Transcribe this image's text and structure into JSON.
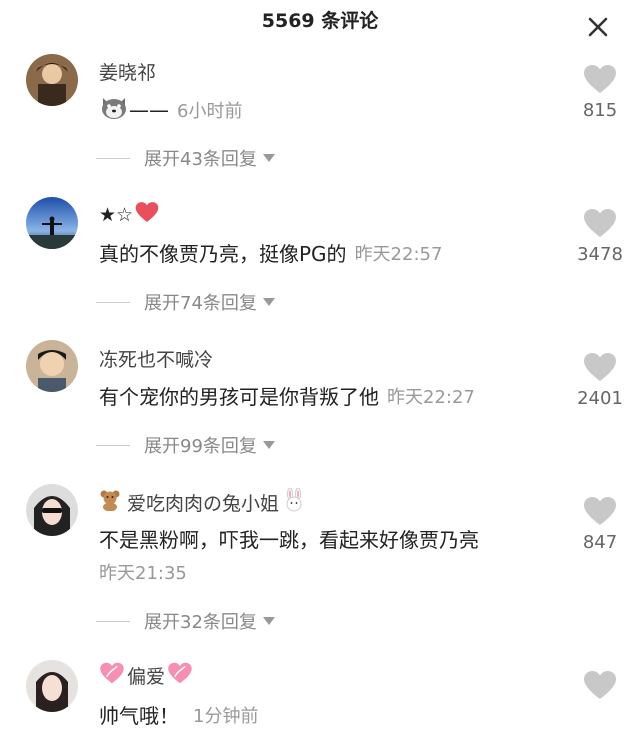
{
  "header": {
    "title": "5569 条评论",
    "close_icon": "close-icon"
  },
  "comments": [
    {
      "username": "姜晓祁",
      "text": "——",
      "time": "6小时前",
      "likes": "815",
      "expand": "展开43条回复"
    },
    {
      "username": "★☆",
      "text": "真的不像贾乃亮，挺像PG的",
      "time": "昨天22:57",
      "likes": "3478",
      "expand": "展开74条回复"
    },
    {
      "username": "冻死也不喊冷",
      "text": "有个宠你的男孩可是你背叛了他",
      "time": "昨天22:27",
      "likes": "2401",
      "expand": "展开99条回复"
    },
    {
      "username": "爱吃肉肉の兔小姐",
      "text": "不是黑粉啊，吓我一跳，看起来好像贾乃亮",
      "time": "昨天21:35",
      "likes": "847",
      "expand": "展开32条回复"
    },
    {
      "username": "偏爱",
      "text": "帅气哦！",
      "time": "1分钟前",
      "likes": ""
    }
  ],
  "colors": {
    "like_icon": "#c8c8c8",
    "muted_text": "#999999",
    "heart": "#e8505b"
  }
}
